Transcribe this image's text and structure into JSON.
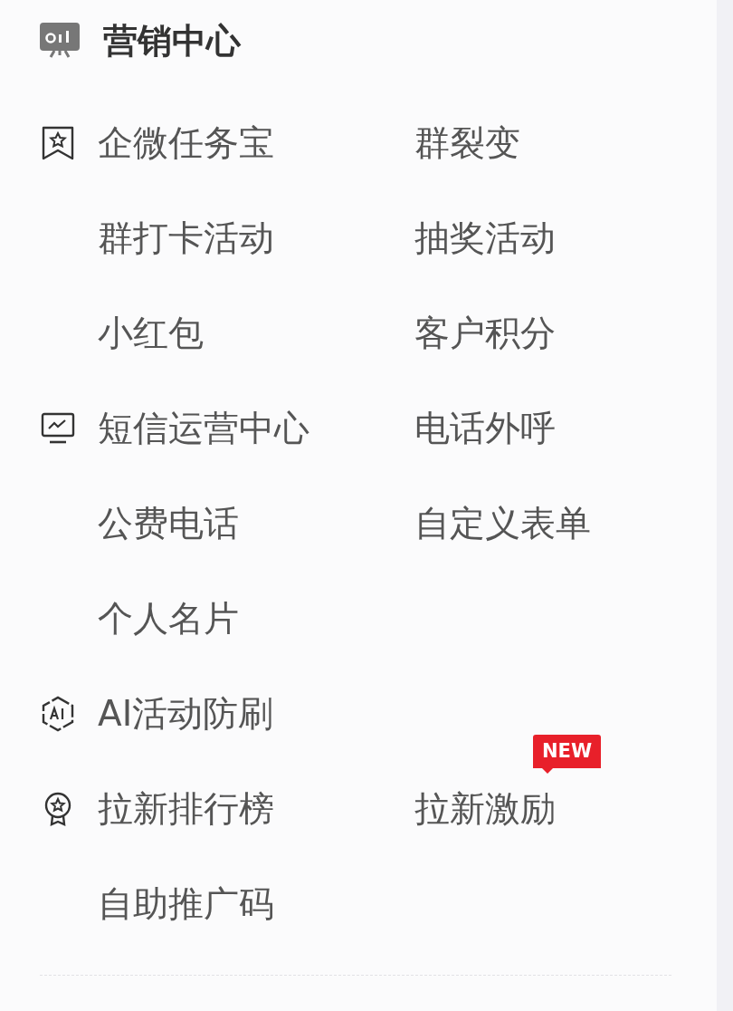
{
  "header": {
    "title": "营销中心"
  },
  "rows": [
    {
      "kind": "headed",
      "items": [
        {
          "label": "企微任务宝"
        },
        {
          "label": "群裂变"
        }
      ]
    },
    {
      "kind": "plain",
      "items": [
        {
          "label": "群打卡活动"
        },
        {
          "label": "抽奖活动"
        }
      ]
    },
    {
      "kind": "plain",
      "items": [
        {
          "label": "小红包"
        },
        {
          "label": "客户积分"
        }
      ]
    },
    {
      "kind": "headed",
      "items": [
        {
          "label": "短信运营中心"
        },
        {
          "label": "电话外呼"
        }
      ]
    },
    {
      "kind": "plain",
      "items": [
        {
          "label": "公费电话"
        },
        {
          "label": "自定义表单"
        }
      ]
    },
    {
      "kind": "plain",
      "items": [
        {
          "label": "个人名片"
        }
      ]
    },
    {
      "kind": "headed",
      "items": [
        {
          "label": "AI活动防刷"
        }
      ]
    },
    {
      "kind": "headed",
      "items": [
        {
          "label": "拉新排行榜"
        },
        {
          "label": "拉新激励",
          "badge": "NEW"
        }
      ]
    },
    {
      "kind": "plain",
      "items": [
        {
          "label": "自助推广码"
        }
      ]
    }
  ]
}
